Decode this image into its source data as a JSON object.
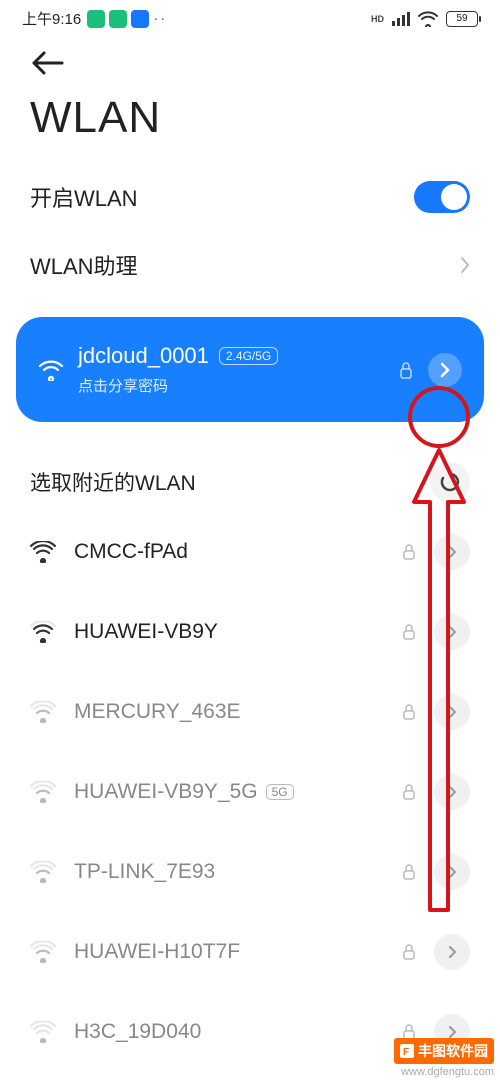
{
  "status": {
    "time": "上午9:16",
    "signal_label": "HD",
    "battery": "59"
  },
  "page": {
    "title": "WLAN"
  },
  "settings": {
    "wlan_enable_label": "开启WLAN",
    "wlan_assistant_label": "WLAN助理"
  },
  "connected": {
    "name": "jdcloud_0001",
    "band": "2.4G/5G",
    "subtext": "点击分享密码"
  },
  "section": {
    "nearby_label": "选取附近的WLAN"
  },
  "networks": [
    {
      "name": "CMCC-fPAd",
      "signal": 4,
      "locked": true,
      "dim": false,
      "badge": ""
    },
    {
      "name": "HUAWEI-VB9Y",
      "signal": 3,
      "locked": true,
      "dim": false,
      "badge": ""
    },
    {
      "name": "MERCURY_463E",
      "signal": 2,
      "locked": true,
      "dim": true,
      "badge": ""
    },
    {
      "name": "HUAWEI-VB9Y_5G",
      "signal": 2,
      "locked": true,
      "dim": true,
      "badge": "5G"
    },
    {
      "name": "TP-LINK_7E93",
      "signal": 2,
      "locked": true,
      "dim": true,
      "badge": ""
    },
    {
      "name": "HUAWEI-H10T7F",
      "signal": 2,
      "locked": true,
      "dim": true,
      "badge": ""
    },
    {
      "name": "H3C_19D040",
      "signal": 1,
      "locked": true,
      "dim": true,
      "badge": ""
    }
  ],
  "watermark": {
    "brand": "丰图软件园",
    "url": "www.dgfengtu.com"
  }
}
